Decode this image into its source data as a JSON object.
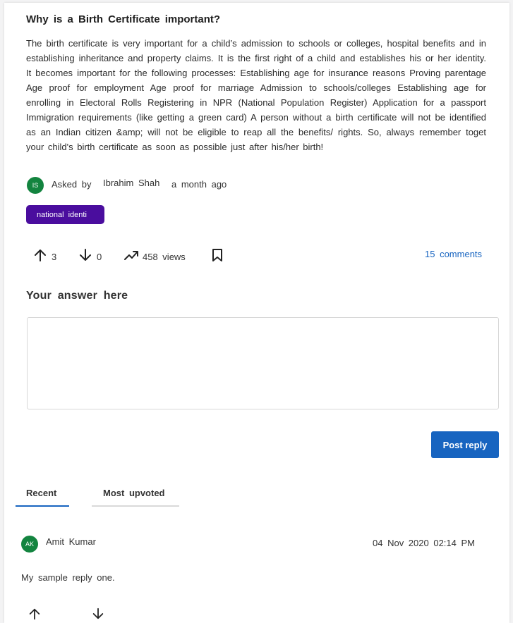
{
  "question": {
    "title": "Why is a Birth Certificate important?",
    "body": "The birth certificate is very important for a child’s admission to schools or colleges, hospital benefits and in establishing inheritance and property claims. It is the first right of a child and establishes his or her identity. It becomes important for the following processes: Establishing age for insurance reasons Proving parentage Age proof for employment Age proof for marriage Admission to schools/colleges Establishing age for enrolling in Electoral Rolls Registering in NPR (National Population Register) Application for a passport Immigration requirements (like getting a green card) A person without a birth certificate will not be identified as an Indian citizen &amp; will not be eligible to reap all the benefits/ rights. So, always remember toget your child's birth certificate as soon as possible just after his/her birth!",
    "author_initials": "IS",
    "asked_by_label": "Asked by",
    "author_name": "Ibrahim Shah",
    "time_ago": "a month ago",
    "tag": "national identi",
    "upvotes": "3",
    "downvotes": "0",
    "views": "458 views",
    "comments_link": "15 comments"
  },
  "answer": {
    "heading": "Your answer here",
    "post_label": "Post reply"
  },
  "tabs": [
    {
      "label": "Recent"
    },
    {
      "label": "Most upvoted"
    }
  ],
  "replies": [
    {
      "initials": "AK",
      "author": "Amit Kumar",
      "date": "04 Nov 2020 02:14 PM",
      "text": "My sample reply one."
    }
  ],
  "colors": {
    "accent": "#1764c0",
    "tag_bg": "#4a0d9e",
    "avatar_bg": "#13843f",
    "active_tab_underline": "#1764c0"
  }
}
